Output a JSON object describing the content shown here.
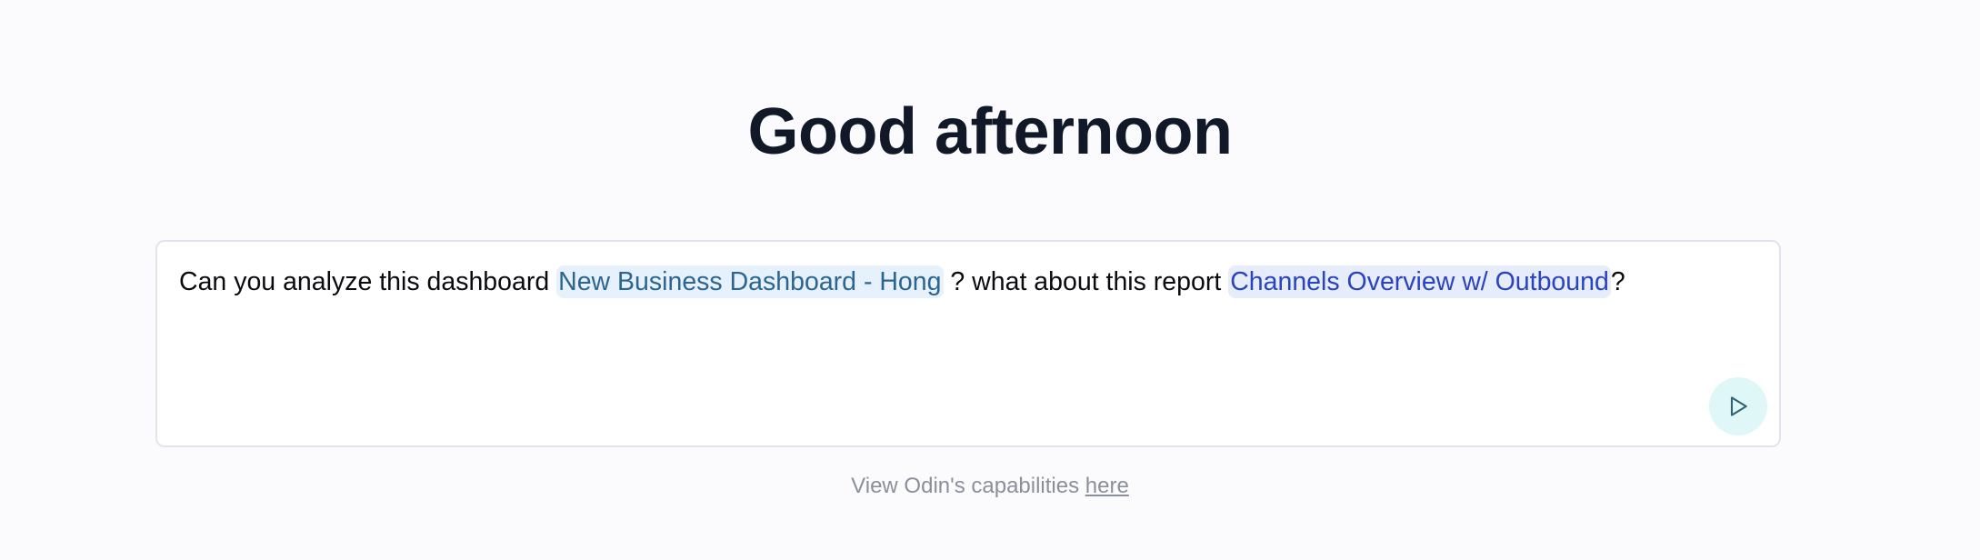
{
  "greeting": "Good afternoon",
  "composer": {
    "text_1": "Can you analyze this dashboard ",
    "mention_dashboard": "New Business Dashboard - Hong",
    "text_2": " ? what about this report ",
    "mention_report": "Channels Overview w/ Outbound",
    "text_3": "?",
    "send_icon": "play-triangle-icon"
  },
  "footer": {
    "prefix": "View Odin's capabilities ",
    "link_label": "here"
  },
  "colors": {
    "background": "#fbfbfd",
    "greeting_text": "#111827",
    "mention_dashboard_bg": "#e6f1fb",
    "mention_dashboard_text": "#2b6591",
    "mention_report_bg": "#e6ecf9",
    "mention_report_text": "#2a43c0",
    "send_button_bg": "#e0f7f7",
    "send_icon": "#2f6473",
    "footer_text": "#8a8f9c"
  }
}
